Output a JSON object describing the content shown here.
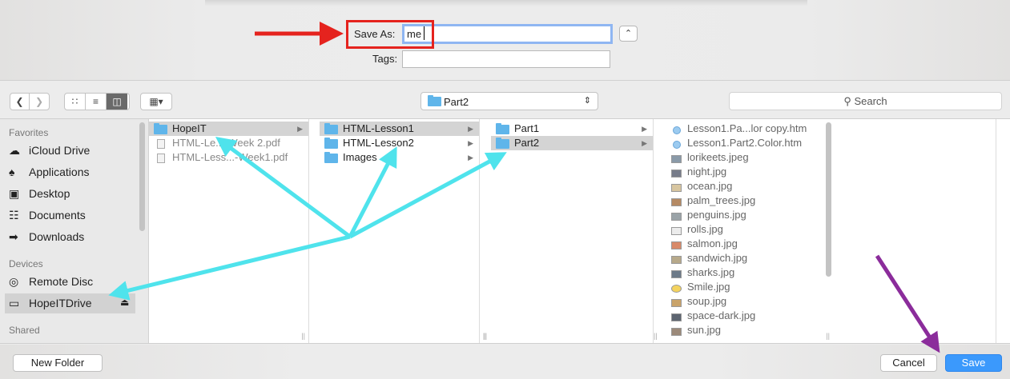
{
  "save_panel": {
    "save_as_label": "Save As:",
    "save_as_value": "me",
    "tags_label": "Tags:",
    "tags_value": "",
    "expand_icon": "chevron-up-icon"
  },
  "toolbar": {
    "back_icon": "chevron-left-icon",
    "forward_icon": "chevron-right-icon",
    "view_modes": [
      "icon-view-icon",
      "list-view-icon",
      "column-view-icon"
    ],
    "active_view": "column",
    "arrange_icon": "arrange-grid-icon",
    "location": "Part2",
    "search_placeholder": "Search"
  },
  "sidebar": {
    "favorites_heading": "Favorites",
    "favorites": [
      {
        "label": "iCloud Drive",
        "icon": "cloud-icon"
      },
      {
        "label": "Applications",
        "icon": "applications-icon"
      },
      {
        "label": "Desktop",
        "icon": "desktop-icon"
      },
      {
        "label": "Documents",
        "icon": "documents-icon"
      },
      {
        "label": "Downloads",
        "icon": "downloads-icon"
      }
    ],
    "devices_heading": "Devices",
    "devices": [
      {
        "label": "Remote Disc",
        "icon": "disc-icon"
      },
      {
        "label": "HopeITDrive",
        "icon": "drive-icon",
        "selected": true,
        "eject_icon": "eject-icon"
      }
    ],
    "shared_heading": "Shared"
  },
  "columns": [
    {
      "items": [
        {
          "label": "HopeIT",
          "kind": "folder",
          "selected": true,
          "has_children": true
        },
        {
          "label": "HTML-Le...-Week 2.pdf",
          "kind": "pdf",
          "dimmed": true
        },
        {
          "label": "HTML-Less...-Week1.pdf",
          "kind": "pdf",
          "dimmed": true
        }
      ]
    },
    {
      "items": [
        {
          "label": "HTML-Lesson1",
          "kind": "folder",
          "selected": true,
          "has_children": true
        },
        {
          "label": "HTML-Lesson2",
          "kind": "folder",
          "has_children": true
        },
        {
          "label": "Images",
          "kind": "folder",
          "has_children": true
        }
      ]
    },
    {
      "items": [
        {
          "label": "Part1",
          "kind": "folder",
          "has_children": true
        },
        {
          "label": "Part2",
          "kind": "folder",
          "selected": true,
          "has_children": true
        }
      ]
    },
    {
      "items": [
        {
          "label": "Lesson1.Pa...lor copy.htm",
          "kind": "htm"
        },
        {
          "label": "Lesson1.Part2.Color.htm",
          "kind": "htm"
        },
        {
          "label": "lorikeets.jpeg",
          "kind": "image"
        },
        {
          "label": "night.jpg",
          "kind": "image"
        },
        {
          "label": "ocean.jpg",
          "kind": "image"
        },
        {
          "label": "palm_trees.jpg",
          "kind": "image"
        },
        {
          "label": "penguins.jpg",
          "kind": "image"
        },
        {
          "label": "rolls.jpg",
          "kind": "image"
        },
        {
          "label": "salmon.jpg",
          "kind": "image"
        },
        {
          "label": "sandwich.jpg",
          "kind": "image"
        },
        {
          "label": "sharks.jpg",
          "kind": "image"
        },
        {
          "label": "Smile.jpg",
          "kind": "image"
        },
        {
          "label": "soup.jpg",
          "kind": "image"
        },
        {
          "label": "space-dark.jpg",
          "kind": "image"
        },
        {
          "label": "sun.jpg",
          "kind": "image"
        }
      ]
    }
  ],
  "footer": {
    "new_folder_label": "New Folder",
    "cancel_label": "Cancel",
    "save_label": "Save"
  },
  "annotations": {
    "highlight_color": "#e5231e",
    "red_arrow_color": "#e5231e",
    "cyan_arrow_color": "#4fe3ec",
    "purple_arrow_color": "#8b2c9b"
  },
  "colors": {
    "accent": "#3b99fc",
    "folder": "#5fb5ea",
    "selection": "#d4d4d4"
  }
}
